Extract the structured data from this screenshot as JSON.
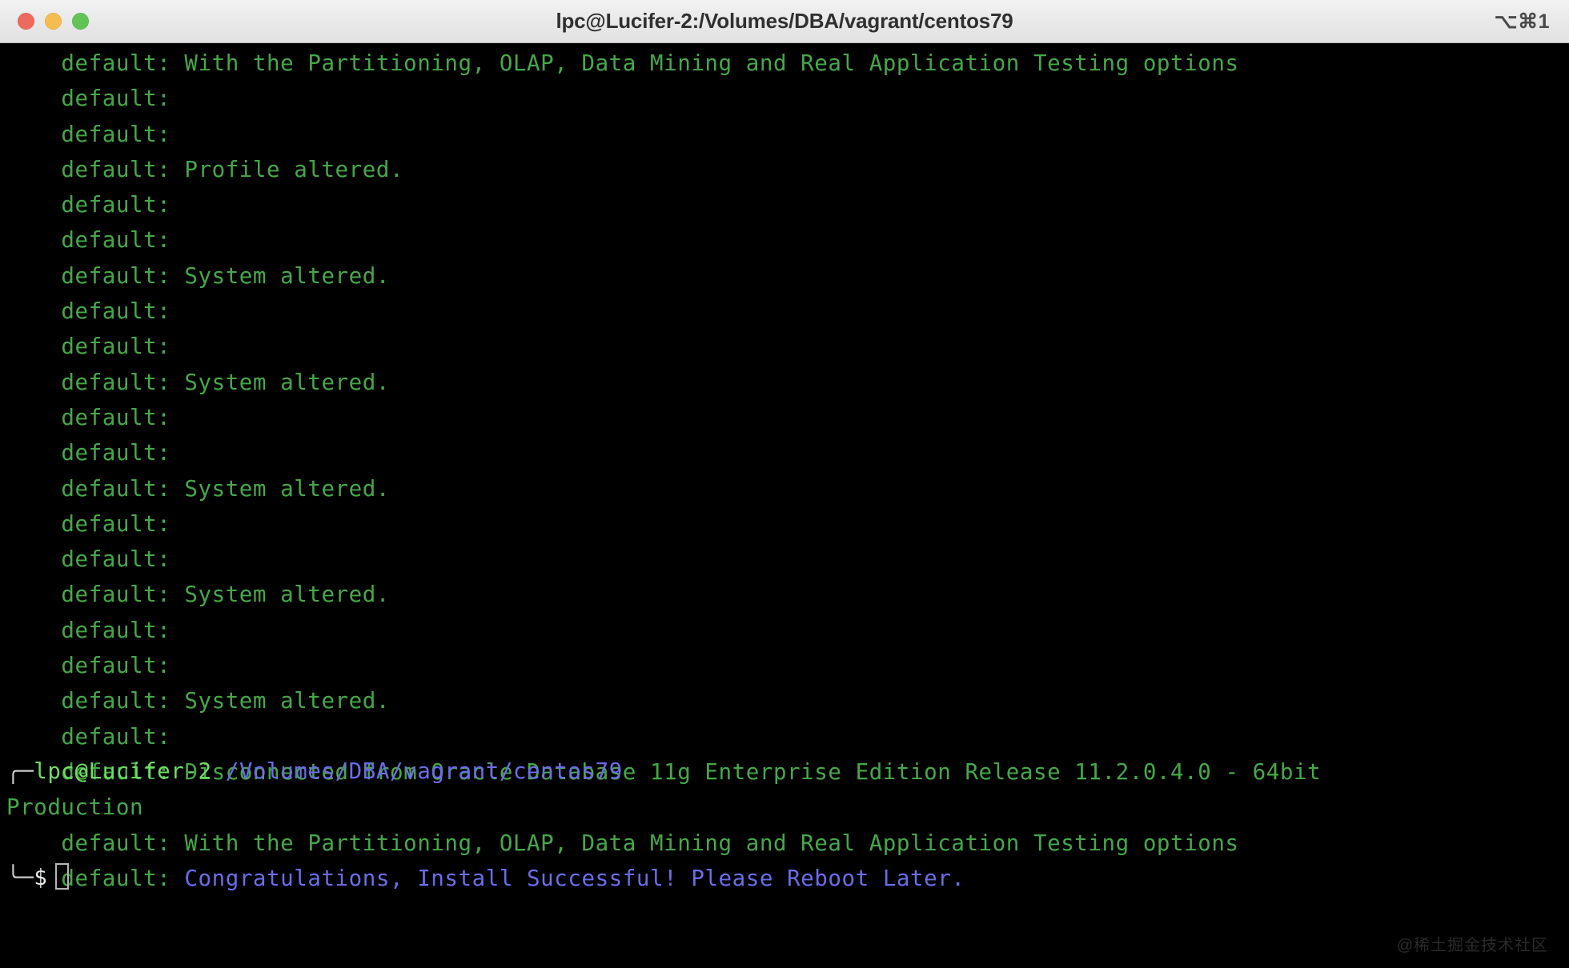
{
  "window": {
    "title": "lpc@Lucifer-2:/Volumes/DBA/vagrant/centos79",
    "shortcut": "⌥⌘1",
    "traffic_lights": {
      "close": "close-button",
      "minimize": "minimize-button",
      "zoom": "zoom-button"
    },
    "colors": {
      "titlebar_bg": "#ebebeb",
      "title_text": "#303030",
      "light_close": "#ed6a5e",
      "light_min": "#f4bd4f",
      "light_zoom": "#61c454",
      "terminal_bg": "#000000",
      "output_green": "#45a849",
      "accent_blue": "#6c6ceb",
      "prompt_green": "#6fdd63",
      "prompt_white": "#e8e8e8",
      "rule_gray": "#c9c9c9",
      "watermark": "#2a2a2a"
    }
  },
  "terminal": {
    "lines": [
      "    default: With the Partitioning, OLAP, Data Mining and Real Application Testing options",
      "    default:",
      "    default:",
      "    default: Profile altered.",
      "    default:",
      "    default:",
      "    default: System altered.",
      "    default:",
      "    default:",
      "    default: System altered.",
      "    default:",
      "    default:",
      "    default: System altered.",
      "    default:",
      "    default:",
      "    default: System altered.",
      "    default:",
      "    default:",
      "    default: System altered.",
      "    default:",
      "    default: Disconnected from Oracle Database 11g Enterprise Edition Release 11.2.0.4.0 - 64bit",
      "Production",
      "    default: With the Partitioning, OLAP, Data Mining and Real Application Testing options"
    ],
    "congrats_line": {
      "prefix": "    default: ",
      "message": "Congratulations, Install Successful! Please Reboot Later."
    },
    "prompt": {
      "top_rule": "╭─",
      "bottom_rule": "╰─",
      "user_host": "lpc@Lucifer-2",
      "path": "/Volumes/DBA/vagrant/centos79",
      "symbol": "$",
      "input_value": ""
    }
  },
  "watermark": {
    "text": "@稀土掘金技术社区"
  }
}
